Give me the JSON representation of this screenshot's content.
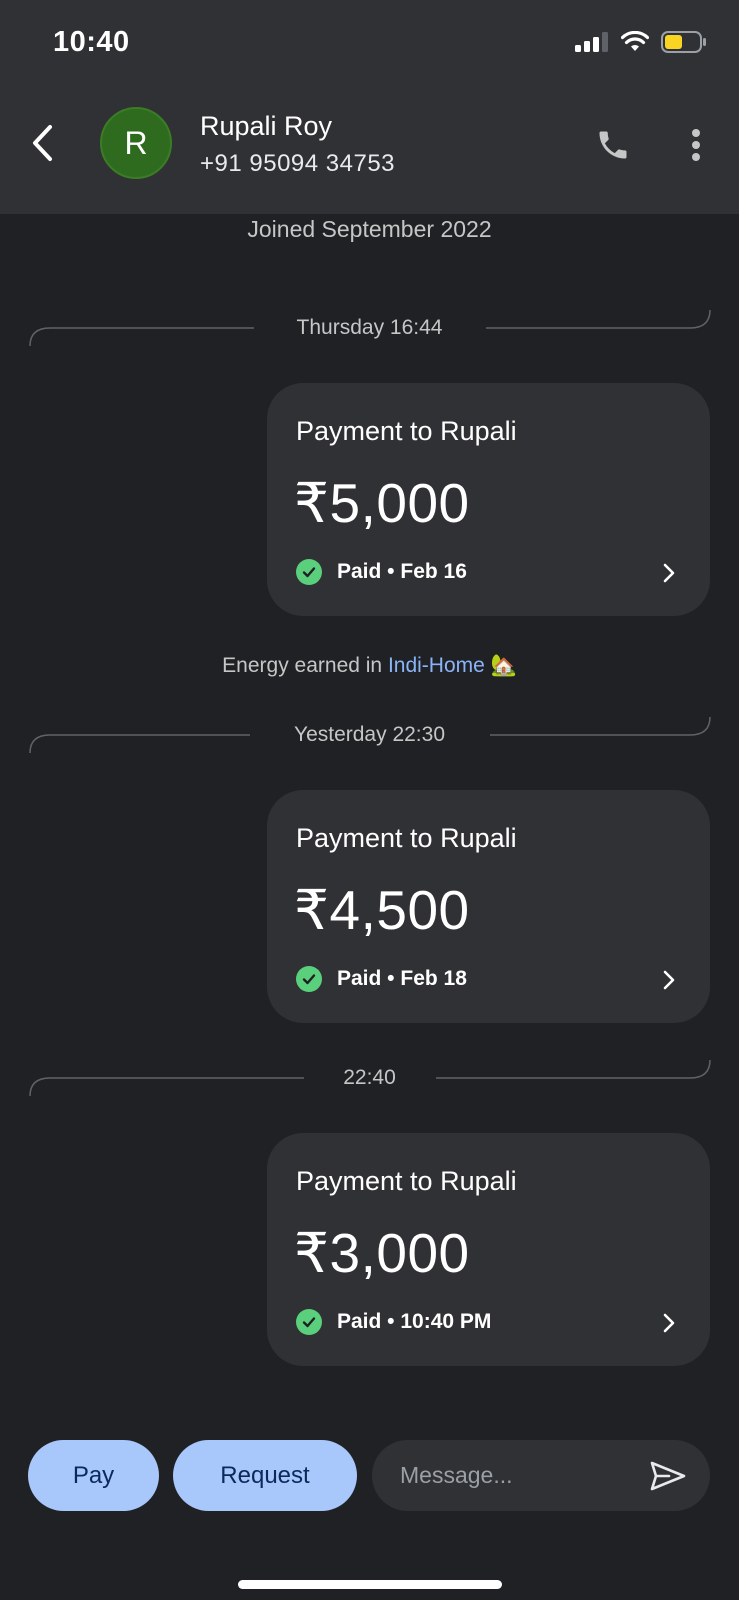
{
  "status_bar": {
    "time": "10:40"
  },
  "header": {
    "avatar_letter": "R",
    "name": "Rupali Roy",
    "phone": "+91 95094 34753"
  },
  "timeline": {
    "joined": "Joined September 2022",
    "dividers": [
      "Thursday 16:44",
      "Yesterday 22:30",
      "22:40"
    ],
    "payments": [
      {
        "title": "Payment to Rupali",
        "amount": "₹5,000",
        "status": "Paid • Feb 16"
      },
      {
        "title": "Payment to Rupali",
        "amount": "₹4,500",
        "status": "Paid • Feb 18"
      },
      {
        "title": "Payment to Rupali",
        "amount": "₹3,000",
        "status": "Paid • 10:40 PM"
      }
    ],
    "energy": {
      "prefix": "Energy earned in ",
      "link": "Indi-Home",
      "emoji": "🏡"
    }
  },
  "bottom_bar": {
    "pay_label": "Pay",
    "request_label": "Request",
    "message_placeholder": "Message..."
  },
  "colors": {
    "header_bg": "#303134",
    "page_bg": "#202124",
    "avatar": "#2f6b1e",
    "paid_check": "#5bd07c",
    "pill_bg": "#a8c7fa",
    "link": "#8ab4f8"
  }
}
